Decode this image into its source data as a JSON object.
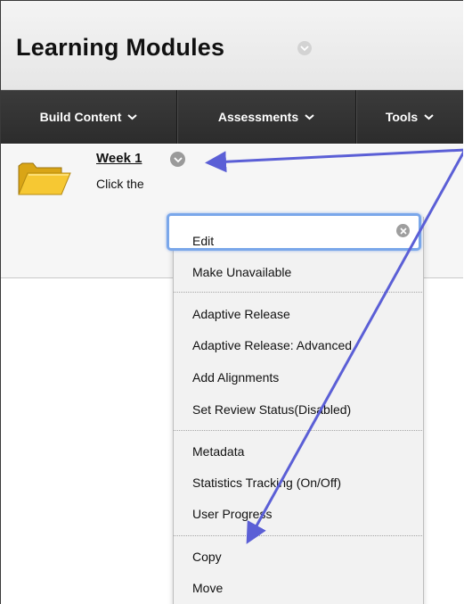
{
  "page": {
    "title": "Learning Modules"
  },
  "toolbar": {
    "buttons": [
      {
        "label": "Build Content"
      },
      {
        "label": "Assessments"
      },
      {
        "label": "Tools"
      }
    ]
  },
  "content_item": {
    "title": "Week 1",
    "description": "Click the",
    "icon": "folder-icon"
  },
  "context_menu": {
    "search_value": "",
    "groups": [
      {
        "items": [
          {
            "label": "Edit"
          },
          {
            "label": "Make Unavailable"
          }
        ]
      },
      {
        "items": [
          {
            "label": "Adaptive Release"
          },
          {
            "label": "Adaptive Release: Advanced"
          },
          {
            "label": "Add Alignments"
          },
          {
            "label": "Set Review Status(Disabled)"
          }
        ]
      },
      {
        "items": [
          {
            "label": "Metadata"
          },
          {
            "label": "Statistics Tracking (On/Off)"
          },
          {
            "label": "User Progress"
          }
        ]
      },
      {
        "items": [
          {
            "label": "Copy"
          },
          {
            "label": "Move"
          }
        ]
      }
    ]
  },
  "colors": {
    "toolbar_bg": "#333333",
    "annotation_arrow": "#5b5fd6",
    "search_focus": "#7aa7ea",
    "folder": "#f2c12e"
  }
}
